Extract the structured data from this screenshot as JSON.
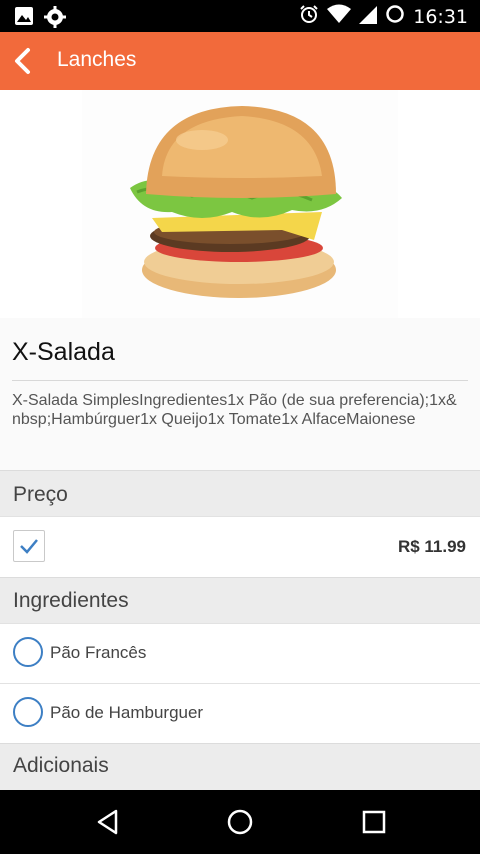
{
  "status_bar": {
    "left_icons": [
      "image-icon",
      "settings-gear-icon"
    ],
    "right_icons": [
      "alarm-icon",
      "wifi-icon",
      "signal-icon",
      "battery-icon"
    ],
    "time": "16:31"
  },
  "app_bar": {
    "back_icon": "chevron-left-icon",
    "title": "Lanches",
    "color": "#f26a3b"
  },
  "product": {
    "image": "burger-image",
    "name": "X-Salada",
    "description": "X-Salada SimplesIngredientes1x Pão (de sua preferencia);1x&nbsp;Hambúrguer1x Queijo1x Tomate1x AlfaceMaionese"
  },
  "sections": {
    "price": {
      "title": "Preço",
      "option": {
        "checked": true,
        "price": "R$ 11.99"
      }
    },
    "ingredients": {
      "title": "Ingredientes",
      "options": [
        {
          "label": "Pão Francês",
          "selected": false
        },
        {
          "label": "Pão de Hamburguer",
          "selected": false
        }
      ]
    },
    "extras": {
      "title": "Adicionais"
    }
  },
  "nav_bar": {
    "icons": [
      "back-triangle-icon",
      "home-circle-icon",
      "recents-square-icon"
    ]
  },
  "colors": {
    "accent_radio": "#3d7fc4",
    "checkmark": "#3d7fc4"
  }
}
